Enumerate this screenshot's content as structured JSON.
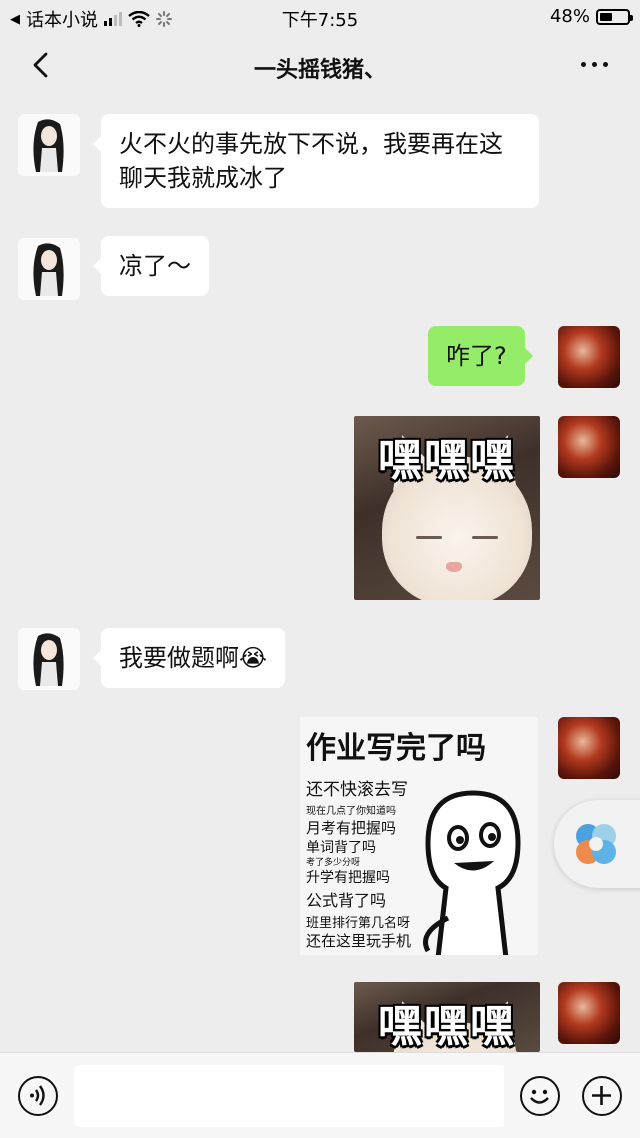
{
  "status_bar": {
    "back_app": "话本小说",
    "time": "下午7:55",
    "battery": "48%",
    "battery_level": 0.48
  },
  "nav": {
    "title": "一头摇钱猪、"
  },
  "messages": [
    {
      "side": "left",
      "text": "火不火的事先放下不说，我要再在这聊天我就成冰了"
    },
    {
      "side": "left",
      "text": "凉了～"
    },
    {
      "side": "right",
      "text": "咋了?"
    },
    {
      "side": "right",
      "sticker": "cat",
      "text": "嘿嘿嘿"
    },
    {
      "side": "left",
      "text": "我要做题啊",
      "emoji": "😭"
    },
    {
      "side": "right",
      "sticker": "meme",
      "title": "作业写完了吗",
      "lines": [
        "还不快滚去写",
        "现在几点了你知道吗",
        "月考有把握吗",
        "单词背了吗",
        "考了多少分呀",
        "升学有把握吗",
        "公式背了吗",
        "班里排行第几名呀",
        "还在这里玩手机"
      ]
    },
    {
      "side": "right",
      "sticker": "cat",
      "text": "嘿嘿嘿"
    }
  ],
  "icons": {
    "back": "chevron-left-icon",
    "more": "more-dots-icon",
    "voice": "voice-icon",
    "emoji": "emoji-icon",
    "plus": "plus-icon",
    "float": "floating-assistant-icon"
  }
}
